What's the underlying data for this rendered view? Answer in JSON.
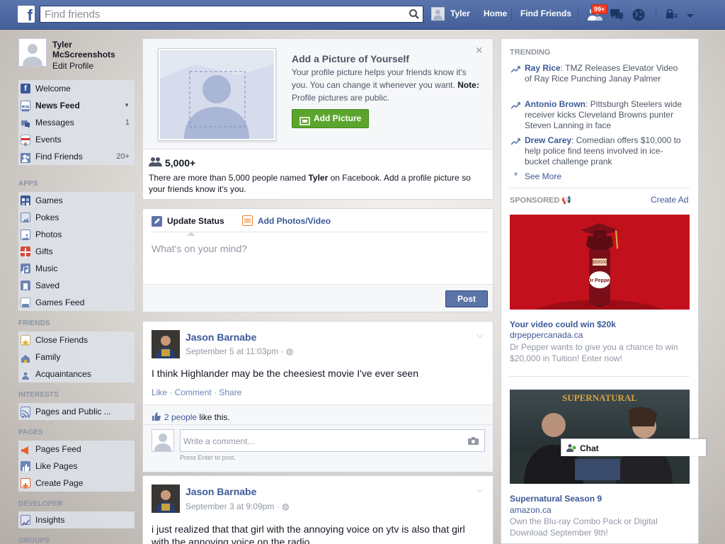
{
  "colors": {
    "brand": "#3b5998",
    "topbar": "#4e69a2",
    "notification_red": "#f03d25",
    "add_picture_green": "#5ba52d"
  },
  "topbar": {
    "logo": "f",
    "search_placeholder": "Find friends",
    "user_name": "Tyler",
    "home": "Home",
    "find_friends": "Find Friends",
    "friend_requests_badge": "99+"
  },
  "sidebar": {
    "profile": {
      "name": "Tyler McScreenshots",
      "edit": "Edit Profile"
    },
    "items": [
      {
        "label": "Welcome",
        "icon": "facebook-icon"
      },
      {
        "label": "News Feed",
        "icon": "news-feed-icon"
      },
      {
        "label": "Messages",
        "icon": "messages-icon",
        "count": "1"
      },
      {
        "label": "Events",
        "icon": "calendar-icon"
      },
      {
        "label": "Find Friends",
        "icon": "find-friends-icon",
        "count": "20+"
      }
    ],
    "apps_heading": "APPS",
    "apps": [
      {
        "label": "Games",
        "icon": "games-icon"
      },
      {
        "label": "Pokes",
        "icon": "pokes-icon"
      },
      {
        "label": "Photos",
        "icon": "photos-icon"
      },
      {
        "label": "Gifts",
        "icon": "gifts-icon"
      },
      {
        "label": "Music",
        "icon": "music-icon"
      },
      {
        "label": "Saved",
        "icon": "saved-icon"
      },
      {
        "label": "Games Feed",
        "icon": "games-feed-icon"
      }
    ],
    "friends_heading": "FRIENDS",
    "friends": [
      {
        "label": "Close Friends",
        "icon": "star-icon"
      },
      {
        "label": "Family",
        "icon": "house-icon"
      },
      {
        "label": "Acquaintances",
        "icon": "acquaintances-icon"
      }
    ],
    "interests_heading": "INTERESTS",
    "interests": [
      {
        "label": "Pages and Public ...",
        "icon": "rss-icon"
      }
    ],
    "pages_heading": "PAGES",
    "pages": [
      {
        "label": "Pages Feed",
        "icon": "megaphone-icon"
      },
      {
        "label": "Like Pages",
        "icon": "thumbs-up-icon"
      },
      {
        "label": "Create Page",
        "icon": "plus-icon"
      }
    ],
    "developer_heading": "DEVELOPER",
    "developer": [
      {
        "label": "Insights",
        "icon": "insights-icon"
      }
    ],
    "groups_heading": "GROUPS"
  },
  "add_picture": {
    "title": "Add a Picture of Yourself",
    "body": "Your profile picture helps your friends know it's you. You can change it whenever you want.",
    "note_label": "Note:",
    "note_text": "Profile pictures are public.",
    "button": "Add Picture",
    "count": "5,000+",
    "stat_pre": "There are more than 5,000 people named ",
    "stat_name": "Tyler",
    "stat_post": " on Facebook. Add a profile picture so your friends know it's you."
  },
  "composer": {
    "tab_status": "Update Status",
    "tab_photos": "Add Photos/Video",
    "placeholder": "What's on your mind?",
    "post": "Post"
  },
  "posts": [
    {
      "author": "Jason Barnabe",
      "date": "September 5 at 11:03pm",
      "text": "I think Highlander may be the cheesiest movie I've ever seen",
      "like": "Like",
      "comment": "Comment",
      "share": "Share",
      "likes_link": "2 people",
      "likes_rest": " like this.",
      "comment_placeholder": "Write a comment...",
      "press_enter": "Press Enter to post."
    },
    {
      "author": "Jason Barnabe",
      "date": "September 3 at 9:09pm",
      "text": "i just realized that that girl with the annoying voice on ytv is also that girl with the annoying voice on the radio"
    }
  ],
  "trending": {
    "heading": "TRENDING",
    "items": [
      {
        "name": "Ray Rice",
        "desc": ": TMZ Releases Elevator Video of Ray Rice Punching Janay Palmer"
      },
      {
        "name": "Antonio Brown",
        "desc": ": Pittsburgh Steelers wide receiver kicks Cleveland Browns punter Steven Lanning in face"
      },
      {
        "name": "Drew Carey",
        "desc": ": Comedian offers $10,000 to help police find teens involved in ice-bucket challenge prank"
      }
    ],
    "see_more": "See More"
  },
  "sponsored": {
    "heading": "SPONSORED",
    "create_ad": "Create Ad",
    "ads": [
      {
        "title": "Your video could win $20k",
        "domain": "drpeppercanada.ca",
        "desc": "Dr Pepper wants to give you a chance to win $20,000 in Tuition! Enter now!",
        "image_text": "Dr Pepper",
        "bottle_label": "$50000"
      },
      {
        "title": "Supernatural Season 9",
        "domain": "amazon.ca",
        "desc": "Own the Blu-ray Combo Pack or Digital Download September 9th!",
        "image_text": "SUPERNATURAL"
      }
    ]
  },
  "chat": {
    "label": "Chat"
  }
}
